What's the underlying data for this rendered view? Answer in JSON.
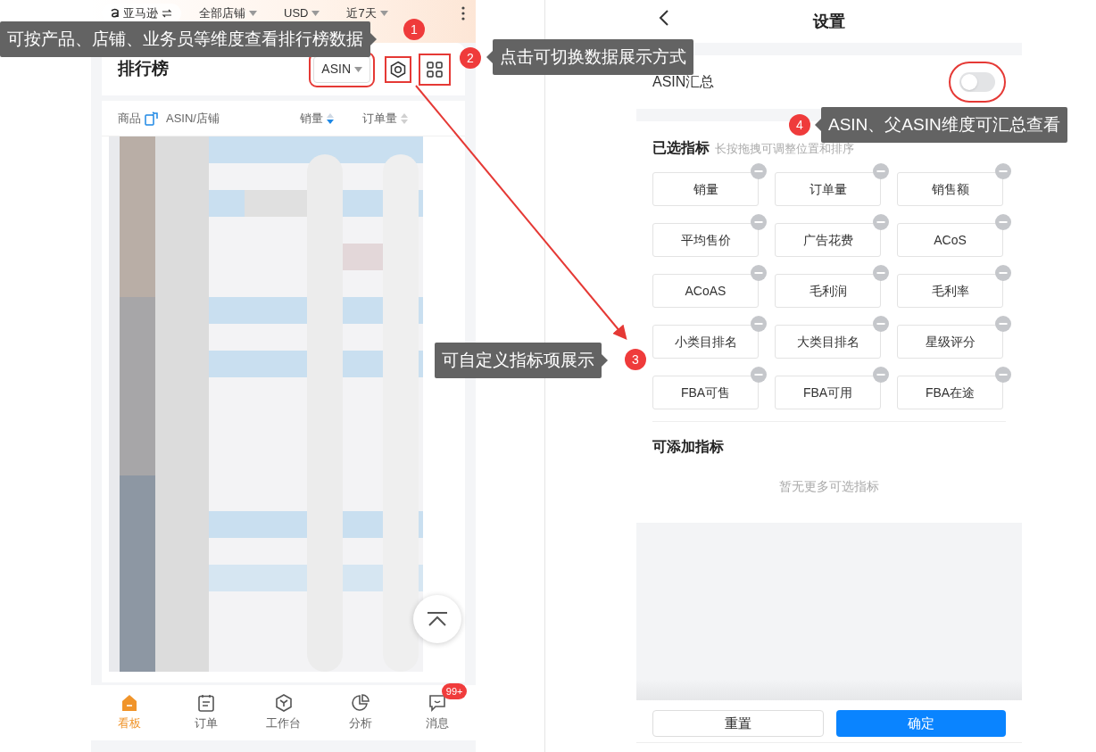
{
  "ranking_screen": {
    "top_bar": {
      "brand": "亚马逊",
      "filters": [
        "全部店铺",
        "USD",
        "近7天"
      ]
    },
    "title": "排行榜",
    "dimension_dropdown": "ASIN",
    "columns": [
      {
        "label": "商品",
        "kind": "icon"
      },
      {
        "label": "ASIN/店铺",
        "kind": "plain"
      },
      {
        "label": "销量",
        "kind": "sort",
        "sorted": true
      },
      {
        "label": "订单量",
        "kind": "sort",
        "sorted": false
      }
    ],
    "nav": [
      {
        "label": "看板",
        "selected": true
      },
      {
        "label": "订单",
        "selected": false
      },
      {
        "label": "工作台",
        "selected": false
      },
      {
        "label": "分析",
        "selected": false
      },
      {
        "label": "消息",
        "selected": false,
        "badge": "99+"
      }
    ]
  },
  "settings_screen": {
    "title": "设置",
    "asin_summary": {
      "label": "ASIN汇总",
      "on": false
    },
    "selected_metrics": {
      "heading": "已选指标",
      "hint": "长按拖拽可调整位置和排序",
      "items": [
        "销量",
        "订单量",
        "销售额",
        "平均售价",
        "广告花费",
        "ACoS",
        "ACoAS",
        "毛利润",
        "毛利率",
        "小类目排名",
        "大类目排名",
        "星级评分",
        "FBA可售",
        "FBA可用",
        "FBA在途"
      ]
    },
    "available_metrics": {
      "heading": "可添加指标",
      "empty_text": "暂无更多可选指标"
    },
    "buttons": [
      {
        "label": "重置",
        "kind": "secondary"
      },
      {
        "label": "确定",
        "kind": "primary"
      }
    ]
  },
  "annotations": [
    {
      "number": "1",
      "text": "可按产品、店铺、业务员等维度查看排行榜数据"
    },
    {
      "number": "2",
      "text": "点击可切换数据展示方式"
    },
    {
      "number": "3",
      "text": "可自定义指标项展示"
    },
    {
      "number": "4",
      "text": "ASIN、父ASIN维度可汇总查看"
    }
  ]
}
